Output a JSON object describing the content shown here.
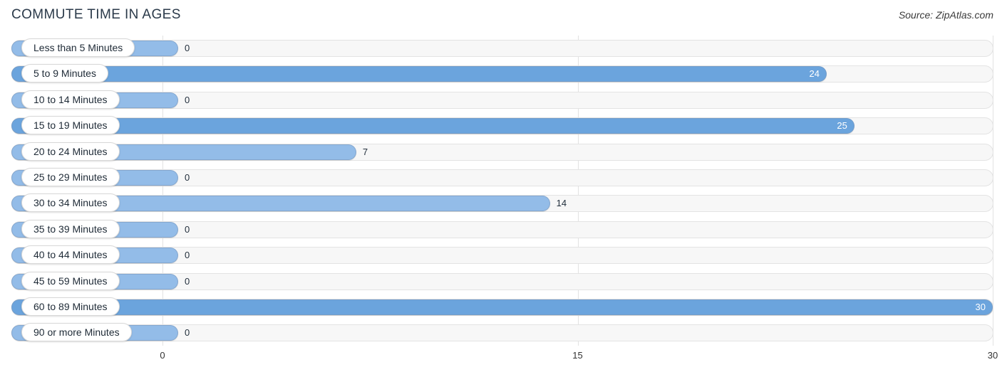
{
  "header": {
    "title": "COMMUTE TIME IN AGES",
    "source": "Source: ZipAtlas.com"
  },
  "chart_data": {
    "type": "bar",
    "orientation": "horizontal",
    "title": "COMMUTE TIME IN AGES",
    "subtitle": "",
    "xlabel": "",
    "ylabel": "",
    "xlim": [
      0,
      30
    ],
    "grid": true,
    "legend": "none",
    "xticks": [
      "0",
      "15",
      "30"
    ],
    "xtick_values": [
      0,
      15,
      30
    ],
    "categories": [
      "Less than 5 Minutes",
      "5 to 9 Minutes",
      "10 to 14 Minutes",
      "15 to 19 Minutes",
      "20 to 24 Minutes",
      "25 to 29 Minutes",
      "30 to 34 Minutes",
      "35 to 39 Minutes",
      "40 to 44 Minutes",
      "45 to 59 Minutes",
      "60 to 89 Minutes",
      "90 or more Minutes"
    ],
    "values": [
      0,
      24,
      0,
      25,
      7,
      0,
      14,
      0,
      0,
      0,
      30,
      0
    ],
    "value_labels": [
      "0",
      "24",
      "0",
      "25",
      "7",
      "0",
      "14",
      "0",
      "0",
      "0",
      "30",
      "0"
    ],
    "colors": {
      "bar_high": "#6ba4dd",
      "bar_low": "#93bce8",
      "track": "#f7f7f7",
      "track_border": "#e3e3e3",
      "gridline": "#e2e2e2",
      "label_text": "#1e2a36",
      "title_text": "#2b3a4a"
    },
    "rows": [
      {
        "label": "Less than 5 Minutes",
        "value": 0,
        "value_label": "0",
        "shade": "low",
        "label_inside": true
      },
      {
        "label": "5 to 9 Minutes",
        "value": 24,
        "value_label": "24",
        "shade": "high",
        "label_inside": true
      },
      {
        "label": "10 to 14 Minutes",
        "value": 0,
        "value_label": "0",
        "shade": "low",
        "label_inside": true
      },
      {
        "label": "15 to 19 Minutes",
        "value": 25,
        "value_label": "25",
        "shade": "high",
        "label_inside": true
      },
      {
        "label": "20 to 24 Minutes",
        "value": 7,
        "value_label": "7",
        "shade": "low",
        "label_inside": false
      },
      {
        "label": "25 to 29 Minutes",
        "value": 0,
        "value_label": "0",
        "shade": "low",
        "label_inside": true
      },
      {
        "label": "30 to 34 Minutes",
        "value": 14,
        "value_label": "14",
        "shade": "low",
        "label_inside": false
      },
      {
        "label": "35 to 39 Minutes",
        "value": 0,
        "value_label": "0",
        "shade": "low",
        "label_inside": true
      },
      {
        "label": "40 to 44 Minutes",
        "value": 0,
        "value_label": "0",
        "shade": "low",
        "label_inside": true
      },
      {
        "label": "45 to 59 Minutes",
        "value": 0,
        "value_label": "0",
        "shade": "low",
        "label_inside": true
      },
      {
        "label": "60 to 89 Minutes",
        "value": 30,
        "value_label": "30",
        "shade": "high",
        "label_inside": true
      },
      {
        "label": "90 or more Minutes",
        "value": 0,
        "value_label": "0",
        "shade": "low",
        "label_inside": true
      }
    ]
  }
}
